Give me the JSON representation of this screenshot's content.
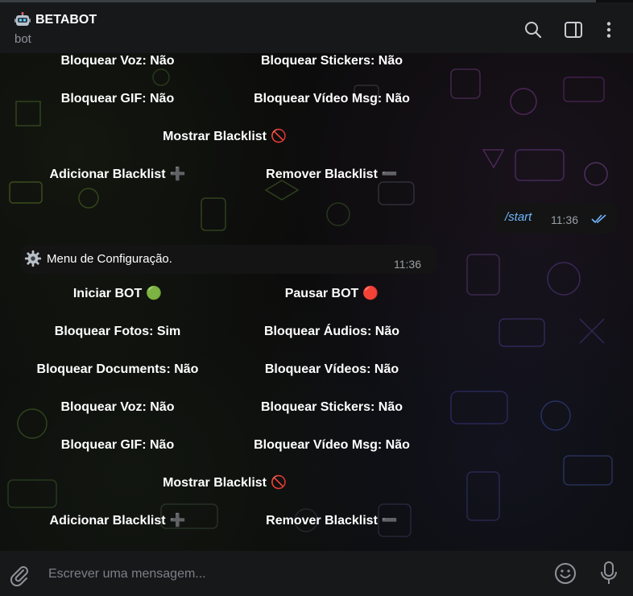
{
  "header": {
    "title": "BETABOT",
    "subtitle": "bot",
    "icons": [
      "search-icon",
      "sidebar-toggle-icon",
      "more-vertical-icon"
    ]
  },
  "keyboard_top": {
    "rows": [
      {
        "left": "Bloquear Voz: Não",
        "right": "Bloquear Stickers: Não"
      },
      {
        "left": "Bloquear GIF: Não",
        "right": "Bloquear Vídeo Msg: Não"
      },
      {
        "full": "Mostrar Blacklist",
        "full_emoji": "🚫"
      },
      {
        "left": "Adicionar Blacklist",
        "left_emoji": "➕",
        "right": "Remover Blacklist",
        "right_emoji": "➖"
      }
    ]
  },
  "outgoing": {
    "text": "/start",
    "time": "11:36",
    "status": "read"
  },
  "incoming": {
    "text": "Menu de Configuração.",
    "time": "11:36",
    "icon": "gear-icon"
  },
  "keyboard_main": {
    "rows": [
      {
        "left": "Iniciar BOT",
        "left_emoji": "🟢",
        "right": "Pausar BOT",
        "right_emoji": "🔴"
      },
      {
        "left": "Bloquear Fotos: Sim",
        "right": "Bloquear Áudios: Não"
      },
      {
        "left": "Bloquear Documents: Não",
        "right": "Bloquear Vídeos: Não"
      },
      {
        "left": "Bloquear Voz: Não",
        "right": "Bloquear Stickers: Não"
      },
      {
        "left": "Bloquear GIF: Não",
        "right": "Bloquear Vídeo Msg: Não"
      },
      {
        "full": "Mostrar Blacklist",
        "full_emoji": "🚫"
      },
      {
        "left": "Adicionar Blacklist",
        "left_emoji": "➕",
        "right": "Remover Blacklist",
        "right_emoji": "➖"
      }
    ]
  },
  "composer": {
    "placeholder": "Escrever uma mensagem..."
  },
  "colors": {
    "accent": "#6fb6ff",
    "background": "#0e0e0e",
    "bar": "#17181a"
  }
}
